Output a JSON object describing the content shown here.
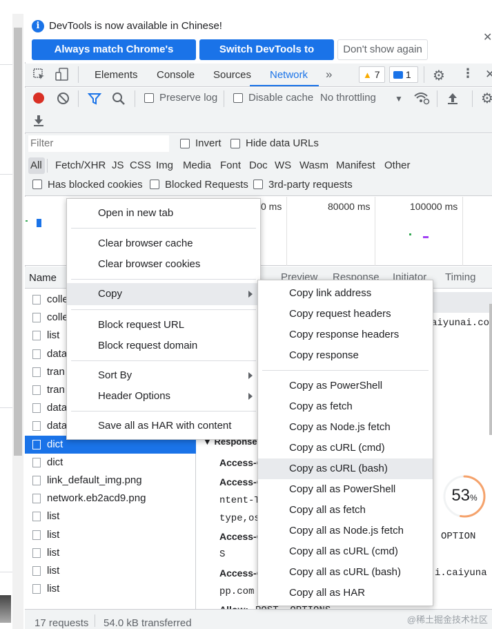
{
  "infobar": {
    "message": "DevTools is now available in Chinese!",
    "btn_match": "Always match Chrome's language",
    "btn_switch": "Switch DevTools to Chinese",
    "btn_dismiss": "Don't show again"
  },
  "tabs": {
    "elements": "Elements",
    "console": "Console",
    "sources": "Sources",
    "network": "Network",
    "more": "»",
    "warnings_count": "7",
    "issues_count": "1"
  },
  "toolbar": {
    "preserve_log": "Preserve log",
    "disable_cache": "Disable cache",
    "throttling": "No throttling"
  },
  "filter": {
    "placeholder": "Filter",
    "invert": "Invert",
    "hide_data_urls": "Hide data URLs",
    "types": [
      "All",
      "Fetch/XHR",
      "JS",
      "CSS",
      "Img",
      "Media",
      "Font",
      "Doc",
      "WS",
      "Wasm",
      "Manifest",
      "Other"
    ],
    "has_blocked_cookies": "Has blocked cookies",
    "blocked_requests": "Blocked Requests",
    "third_party": "3rd-party requests"
  },
  "overview": {
    "tick_1": "0 ms",
    "tick_2": "80000 ms",
    "tick_3": "100000 ms"
  },
  "columns": {
    "name": "Name",
    "preview": "Preview",
    "response": "Response",
    "initiator": "Initiator",
    "timing": "Timing"
  },
  "requests": [
    {
      "name": "colle"
    },
    {
      "name": "colle"
    },
    {
      "name": "list"
    },
    {
      "name": "data"
    },
    {
      "name": "tran"
    },
    {
      "name": "tran"
    },
    {
      "name": "data"
    },
    {
      "name": "data"
    },
    {
      "name": "dict"
    },
    {
      "name": "dict"
    },
    {
      "name": "link_default_img.png"
    },
    {
      "name": "network.eb2acd9.png"
    },
    {
      "name": "list"
    },
    {
      "name": "list"
    },
    {
      "name": "list"
    },
    {
      "name": "list"
    },
    {
      "name": "list"
    }
  ],
  "details": {
    "right_text_1": "aiyunai.co",
    "response_section": "Response",
    "access_1": "Access-C",
    "access_2": "Access-C",
    "ntent": "ntent-T",
    "type_os": "type,os",
    "access_3": "Access-C",
    "s_char": "S",
    "option_text": "OPTION",
    "access_4": "Access-C",
    "caiyuna": "i.caiyuna",
    "pp_com": "pp.com",
    "allow_label": "Allow:",
    "allow_value": "POST, OPTIONS"
  },
  "status": {
    "requests": "17 requests",
    "transferred": "54.0 kB transferred"
  },
  "context_menu": {
    "open_new_tab": "Open in new tab",
    "clear_cache": "Clear browser cache",
    "clear_cookies": "Clear browser cookies",
    "copy": "Copy",
    "block_url": "Block request URL",
    "block_domain": "Block request domain",
    "sort_by": "Sort By",
    "header_options": "Header Options",
    "save_har": "Save all as HAR with content"
  },
  "copy_submenu": {
    "link_address": "Copy link address",
    "request_headers": "Copy request headers",
    "response_headers": "Copy response headers",
    "response": "Copy response",
    "powershell": "Copy as PowerShell",
    "fetch": "Copy as fetch",
    "node_fetch": "Copy as Node.js fetch",
    "curl_cmd": "Copy as cURL (cmd)",
    "curl_bash": "Copy as cURL (bash)",
    "all_powershell": "Copy all as PowerShell",
    "all_fetch": "Copy all as fetch",
    "all_node_fetch": "Copy all as Node.js fetch",
    "all_curl_cmd": "Copy all as cURL (cmd)",
    "all_curl_bash": "Copy all as cURL (bash)",
    "all_har": "Copy all as HAR"
  },
  "overlay": {
    "progress_value": "53",
    "progress_unit": "%",
    "progress_fraction": 0.53
  },
  "watermark": "@稀土掘金技术社区",
  "colors": {
    "accent": "#1a73e8",
    "record_red": "#d93025",
    "warning_yellow": "#f9ab00",
    "progress_orange": "#f5a26b"
  }
}
